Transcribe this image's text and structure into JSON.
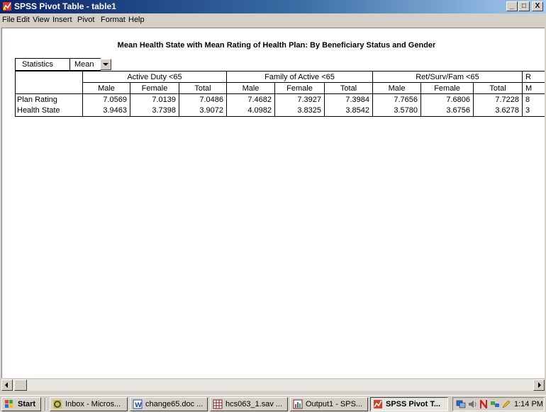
{
  "window": {
    "title": "SPSS Pivot Table - table1",
    "controls": [
      "_",
      "□",
      "X"
    ]
  },
  "menu": [
    "File",
    "Edit",
    "View",
    "Insert",
    "Pivot",
    "Format",
    "Help"
  ],
  "pivot": {
    "title": "Mean Health State with Mean Rating of Health Plan: By Beneficiary Status and Gender",
    "layer_label": "Statistics",
    "layer_value": "Mean",
    "groups": [
      "Active Duty <65",
      "Family of Active <65",
      "Ret/Surv/Fam <65",
      "R"
    ],
    "subheaders": [
      "Male",
      "Female",
      "Total",
      "Male",
      "Female",
      "Total",
      "Male",
      "Female",
      "Total",
      "M"
    ],
    "rows": [
      {
        "label": "Plan Rating",
        "values": [
          "7.0569",
          "7.0139",
          "7.0486",
          "7.4682",
          "7.3927",
          "7.3984",
          "7.7656",
          "7.6806",
          "7.7228",
          "8"
        ]
      },
      {
        "label": "Health State",
        "values": [
          "3.9463",
          "3.7398",
          "3.9072",
          "4.0982",
          "3.8325",
          "3.8542",
          "3.5780",
          "3.6756",
          "3.6278",
          "3"
        ]
      }
    ]
  },
  "taskbar": {
    "start": "Start",
    "tasks": [
      "Inbox - Micros...",
      "change65.doc ...",
      "hcs063_1.sav ...",
      "Output1 - SPS...",
      "SPSS Pivot T..."
    ],
    "clock": "1:14 PM"
  },
  "colors": {
    "titlebar_start": "#0a246a",
    "titlebar_end": "#a6caf0",
    "chrome": "#d4d0c8"
  }
}
